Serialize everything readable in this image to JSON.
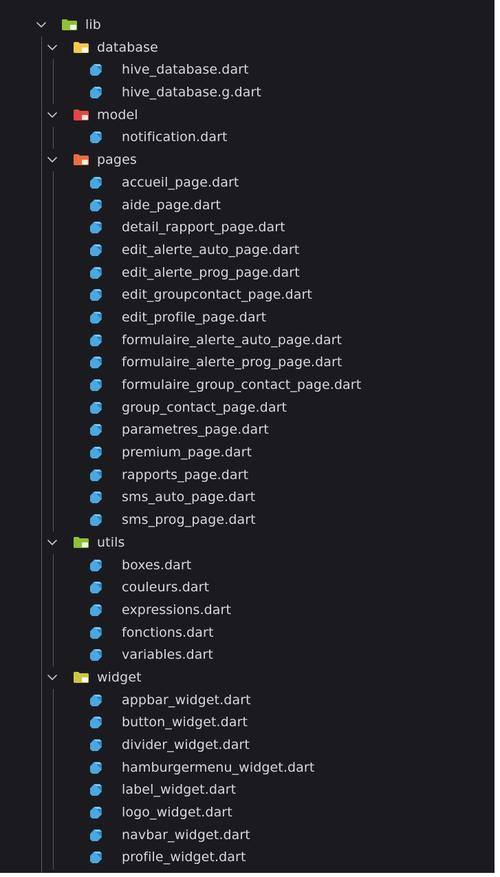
{
  "explorer": {
    "root": {
      "name": "lib",
      "icon": "folder-lib-icon",
      "color": "#8fbf3a",
      "expanded": true
    },
    "folders": [
      {
        "name": "database",
        "icon": "folder-database-icon",
        "color": "#f2c94c",
        "expanded": true,
        "files": [
          "hive_database.dart",
          "hive_database.g.dart"
        ]
      },
      {
        "name": "model",
        "icon": "folder-model-icon",
        "color": "#e0483e",
        "expanded": true,
        "files": [
          "notification.dart"
        ]
      },
      {
        "name": "pages",
        "icon": "folder-pages-icon",
        "color": "#ef6c3e",
        "expanded": true,
        "files": [
          "accueil_page.dart",
          "aide_page.dart",
          "detail_rapport_page.dart",
          "edit_alerte_auto_page.dart",
          "edit_alerte_prog_page.dart",
          "edit_groupcontact_page.dart",
          "edit_profile_page.dart",
          "formulaire_alerte_auto_page.dart",
          "formulaire_alerte_prog_page.dart",
          "formulaire_group_contact_page.dart",
          "group_contact_page.dart",
          "parametres_page.dart",
          "premium_page.dart",
          "rapports_page.dart",
          "sms_auto_page.dart",
          "sms_prog_page.dart"
        ]
      },
      {
        "name": "utils",
        "icon": "folder-utils-icon",
        "color": "#8fbf3a",
        "expanded": true,
        "files": [
          "boxes.dart",
          "couleurs.dart",
          "expressions.dart",
          "fonctions.dart",
          "variables.dart"
        ]
      },
      {
        "name": "widget",
        "icon": "folder-widget-icon",
        "color": "#c9c843",
        "expanded": true,
        "files": [
          "appbar_widget.dart",
          "button_widget.dart",
          "divider_widget.dart",
          "hamburgermenu_widget.dart",
          "label_widget.dart",
          "logo_widget.dart",
          "navbar_widget.dart",
          "profile_widget.dart"
        ]
      }
    ],
    "file_icon": "dart-file-icon",
    "file_icon_color": "#4aa8e0",
    "chevron_icon": "chevron-down-icon",
    "background": "#1b1b1f",
    "text_color": "#d8d8dc"
  }
}
